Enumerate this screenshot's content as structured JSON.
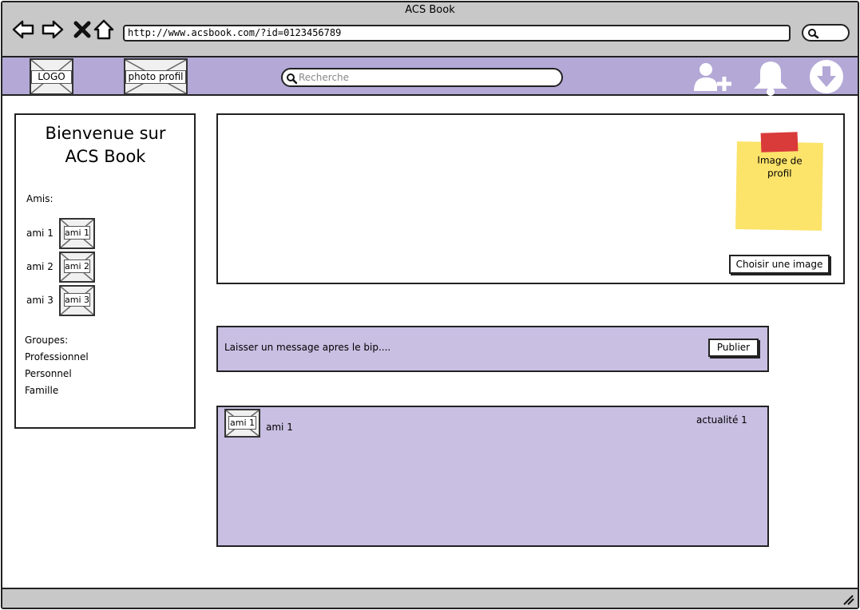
{
  "window": {
    "title": "ACS Book"
  },
  "browser": {
    "url": "http://www.acsbook.com/?id=0123456789"
  },
  "appbar": {
    "logo_label": "LOGO",
    "photo_label": "photo profil",
    "search_placeholder": "Recherche",
    "icons": [
      "add-friend-icon",
      "bell-icon",
      "download-icon"
    ],
    "bar_color": "#b3a8d6"
  },
  "sidebar": {
    "welcome_line1": "Bienvenue sur",
    "welcome_line2": "ACS Book",
    "friends_heading": "Amis:",
    "friends": [
      {
        "name": "ami 1",
        "thumb": "ami 1"
      },
      {
        "name": "ami 2",
        "thumb": "ami 2"
      },
      {
        "name": "ami 3",
        "thumb": "ami 3"
      }
    ],
    "groups_heading": "Groupes:",
    "groups": [
      "Professionnel",
      "Personnel",
      "Famille"
    ]
  },
  "cover": {
    "sticky_note": "Image de profil",
    "choose_button": "Choisir une image",
    "sticky_color": "#fce36a",
    "tape_color": "#d93a3a"
  },
  "composer": {
    "placeholder": "Laisser un message apres le bip....",
    "publish_button": "Publier",
    "panel_color": "#c8bfe2"
  },
  "feed": [
    {
      "author_thumb": "ami 1",
      "author": "ami 1",
      "title": "actualité 1"
    }
  ]
}
